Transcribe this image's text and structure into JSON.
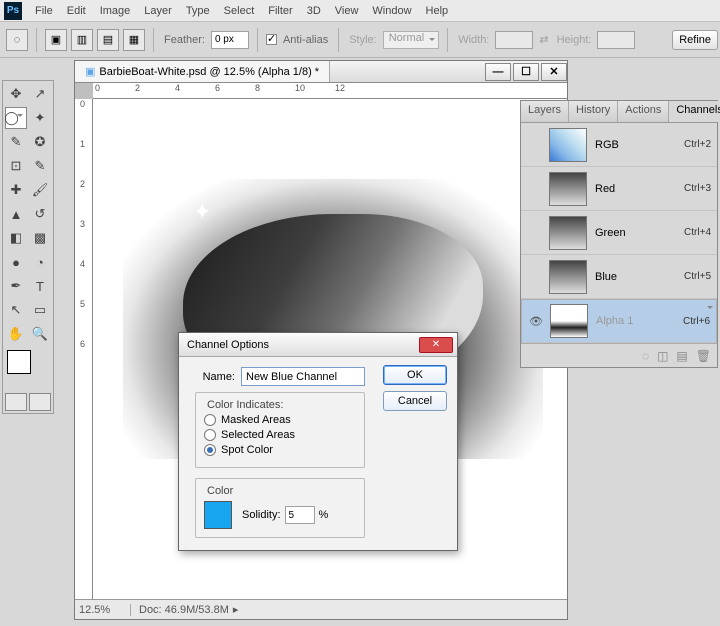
{
  "menu": {
    "items": [
      "File",
      "Edit",
      "Image",
      "Layer",
      "Type",
      "Select",
      "Filter",
      "3D",
      "View",
      "Window",
      "Help"
    ]
  },
  "options": {
    "feather_label": "Feather:",
    "feather_value": "0 px",
    "antialias": "Anti-alias",
    "style_label": "Style:",
    "style_value": "Normal",
    "width_label": "Width:",
    "width_value": "",
    "height_label": "Height:",
    "height_value": "",
    "refine": "Refine"
  },
  "doc": {
    "tab_title": "BarbieBoat-White.psd @ 12.5% (Alpha 1/8) *",
    "zoom": "12.5%",
    "docinfo": "Doc: 46.9M/53.8M",
    "ruler_h": [
      "0",
      "2",
      "4",
      "6",
      "8",
      "10",
      "12"
    ],
    "ruler_v": [
      "0",
      "1",
      "2",
      "3",
      "4",
      "5",
      "6"
    ]
  },
  "panel": {
    "tabs": [
      "Layers",
      "History",
      "Actions",
      "Channels"
    ],
    "rows": [
      {
        "name": "RGB",
        "key": "Ctrl+2",
        "thumb": "rgb"
      },
      {
        "name": "Red",
        "key": "Ctrl+3",
        "thumb": ""
      },
      {
        "name": "Green",
        "key": "Ctrl+4",
        "thumb": ""
      },
      {
        "name": "Blue",
        "key": "Ctrl+5",
        "thumb": ""
      },
      {
        "name": "Alpha 1",
        "key": "Ctrl+6",
        "thumb": "alpha",
        "sel": true,
        "eye": true
      }
    ]
  },
  "dialog": {
    "title": "Channel Options",
    "name_label": "Name:",
    "name_value": "New Blue Channel",
    "ok": "OK",
    "cancel": "Cancel",
    "indicates_legend": "Color Indicates:",
    "radios": [
      "Masked Areas",
      "Selected Areas",
      "Spot Color"
    ],
    "radio_selected": 2,
    "color_legend": "Color",
    "solidity_label": "Solidity:",
    "solidity_value": "5",
    "solidity_pct": "%",
    "swatch": "#19a6f0"
  }
}
